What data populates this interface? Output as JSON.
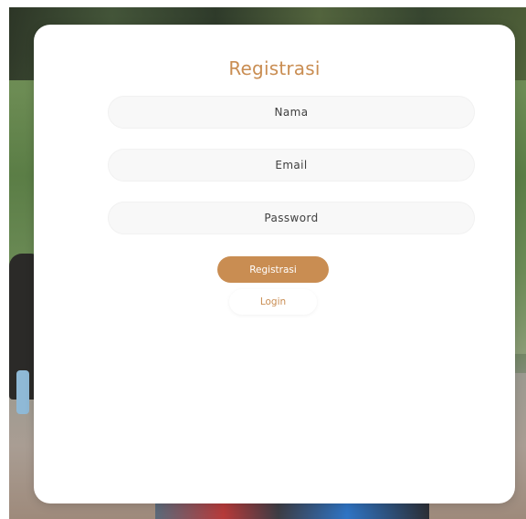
{
  "form": {
    "title": "Registrasi",
    "fields": {
      "name": {
        "placeholder": "Nama"
      },
      "email": {
        "placeholder": "Email"
      },
      "password": {
        "placeholder": "Password"
      }
    },
    "buttons": {
      "register_label": "Registrasi",
      "login_label": "Login"
    }
  },
  "colors": {
    "accent": "#c98d52",
    "card_bg": "#ffffff",
    "field_bg": "#f8f8f8",
    "text": "#3f3f3f"
  }
}
